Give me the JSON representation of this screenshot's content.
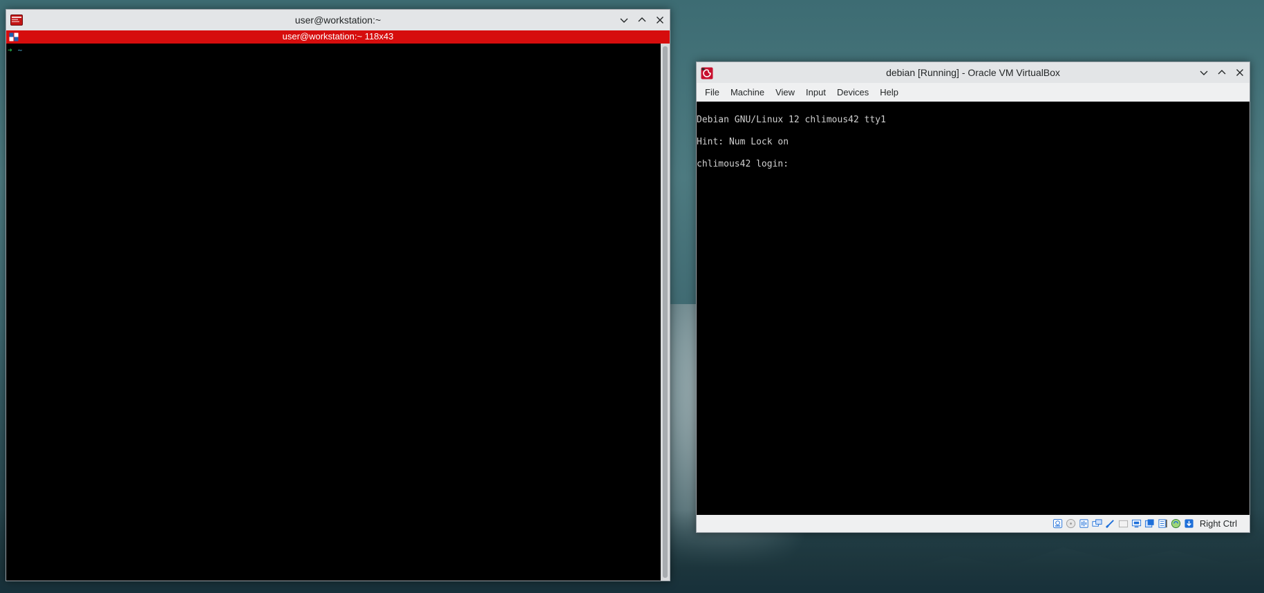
{
  "terminal": {
    "window_title": "user@workstation:~",
    "tab_title": "user@workstation:~ 118x43",
    "prompt_arrow": "➜",
    "prompt_dir": "~",
    "app_icon": "terminal-icon",
    "tab_color": "#d60d0d"
  },
  "vbox": {
    "window_title": "debian [Running] - Oracle VM VirtualBox",
    "app_icon": "virtualbox-icon",
    "menu": [
      "File",
      "Machine",
      "View",
      "Input",
      "Devices",
      "Help"
    ],
    "console_lines": [
      "Debian GNU/Linux 12 chlimous42 tty1",
      "Hint: Num Lock on",
      "chlimous42 login:"
    ],
    "status_icons": [
      "hard-disk-icon",
      "optical-drive-icon",
      "audio-icon",
      "network-icon",
      "usb-icon",
      "shared-folders-icon",
      "display-icon",
      "recording-icon",
      "cpu-icon",
      "virtualization-icon",
      "mouse-integration-icon",
      "keyboard-icon"
    ],
    "host_key": "Right Ctrl"
  },
  "window_controls": {
    "minimize": "minimize-icon",
    "maximize": "maximize-icon",
    "close": "close-icon"
  }
}
